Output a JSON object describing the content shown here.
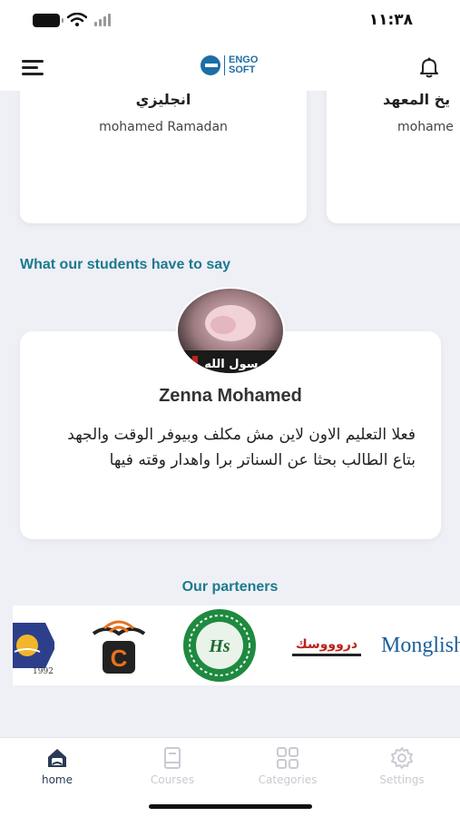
{
  "status_bar": {
    "time": "١١:٣٨"
  },
  "header": {
    "logo_top": "ENGO",
    "logo_bottom": "SOFT"
  },
  "teachers": [
    {
      "subject": "انجليزي",
      "teacher": "mohamed Ramadan"
    },
    {
      "subject": "يخ المعهد",
      "teacher": "mohame"
    }
  ],
  "testimonials": {
    "title": "What our students have to say",
    "avatar_caption": "رسول الله",
    "name": "Zenna Mohamed",
    "text": "فعلا التعليم الاون لاين مش مكلف وبيوفر الوقت والجهد بتاع الطالب بحثا عن السناتر برا واهدار وقته فيها"
  },
  "partners": {
    "title": "Our parteners",
    "items": [
      {
        "name": "1992-logo",
        "text": "1992"
      },
      {
        "name": "c-book-logo",
        "text": "C"
      },
      {
        "name": "hs-geography-logo",
        "text": "Hs"
      },
      {
        "name": "dardasha-logo",
        "text": "دروووسك"
      },
      {
        "name": "monglish-logo",
        "text": "Monglish"
      }
    ]
  },
  "tabs": [
    {
      "label": "home",
      "icon": "home-icon",
      "active": true
    },
    {
      "label": "Courses",
      "icon": "book-icon",
      "active": false
    },
    {
      "label": "Categories",
      "icon": "grid-icon",
      "active": false
    },
    {
      "label": "Settings",
      "icon": "gear-icon",
      "active": false
    }
  ],
  "colors": {
    "accent": "#1c7a8c",
    "brand": "#1d6ea6",
    "active_tab": "#2b3a55",
    "inactive_tab": "#c9cbd2"
  }
}
